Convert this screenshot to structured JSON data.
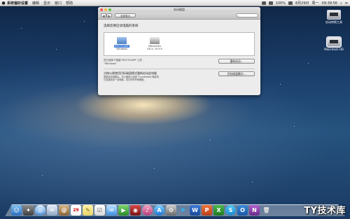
{
  "menubar": {
    "apple": "",
    "app_name": "系统偏好设置",
    "items": [
      "编辑",
      "显示",
      "窗口",
      "帮助"
    ],
    "status": {
      "battery": "100%",
      "date": "8月29日",
      "weekday": "周一",
      "time": "09:39:56"
    }
  },
  "desktop_icons": [
    {
      "label": "启动转换工具"
    },
    {
      "label": "Macintosh HD"
    }
  ],
  "window": {
    "title": "启动磁盘",
    "show_all_label": "全部显示",
    "search_placeholder": "",
    "heading": "选择您要启动电脑的系统",
    "disks": [
      {
        "name": "BOOTCAMP",
        "os": "Windows",
        "selected": true
      },
      {
        "name": "Mavericks",
        "os": "OS X, 10.9.5",
        "selected": false
      }
    ],
    "selection_info": "您已选择了磁盘“BOOTCAMP”上的\n“Windows”",
    "restart_button": "重新启动…",
    "target_title": "点按以便使用目标磁盘模式重新启动此电脑",
    "target_info": "重新启动电脑后，可以使用火线或 Thunderbolt 电缆将\n它连接到另一台电脑，将它用作外置硬盘。",
    "target_button": "目标磁盘模式…"
  },
  "dock": {
    "icons": [
      "finder",
      "launchpad",
      "safari",
      "mail",
      "contacts",
      "calendar",
      "notes",
      "reminders",
      "messages",
      "facetime",
      "photo-booth",
      "itunes",
      "app-store",
      "system-preferences",
      "arrow",
      "word",
      "powerpoint",
      "excel",
      "skype",
      "outlook",
      "onenote",
      "trash"
    ],
    "calendar_day": "29"
  },
  "watermark": "TY技术库"
}
